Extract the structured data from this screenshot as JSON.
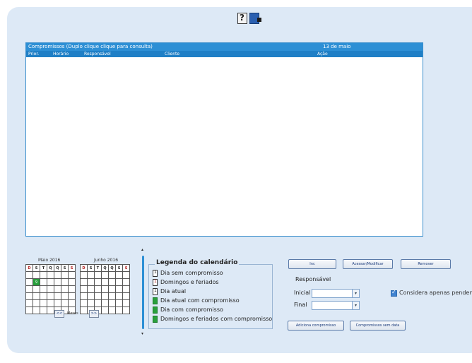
{
  "toolbar": {
    "icons": [
      "help-icon",
      "exit-icon"
    ]
  },
  "grid": {
    "caption": "Compromissos (Duplo clique clique para consulta)",
    "caption_right": "13 de maio",
    "columns": [
      "Prior.",
      "Horário",
      "Responsável",
      "Cliente",
      "Ação"
    ]
  },
  "calendar": {
    "month_left": "Maio 2016",
    "month_right": "Junho 2016",
    "weekday_headers": [
      "D",
      "S",
      "T",
      "Q",
      "Q",
      "S",
      "S"
    ],
    "nav_prev": "<<",
    "nav_label": "Meses",
    "nav_next": ">>",
    "today_day": "9",
    "today_color": "#28a03c"
  },
  "legend": {
    "title": "Legenda do calendário",
    "items": [
      {
        "label": "Dia sem compromisso",
        "swatch": "white",
        "num": "1"
      },
      {
        "label": "Domingos e feriados",
        "swatch": "white-red",
        "num": "1"
      },
      {
        "label": "Dia atual",
        "swatch": "white",
        "num": "1"
      },
      {
        "label": "Dia atual com compromisso",
        "swatch": "green"
      },
      {
        "label": "Dia com compromisso",
        "swatch": "green"
      },
      {
        "label": "Domingos e feriados com compromisso",
        "swatch": "green"
      }
    ]
  },
  "actions": {
    "btn1": "Inc",
    "btn2": "Acessar/Modificar",
    "btn3": "Remover",
    "responsavel_title": "Responsável",
    "inicial_label": "Inicial",
    "final_label": "Final",
    "inicial_value": "",
    "final_value": "",
    "add_btn": "Adiciona compromisso",
    "nodate_btn": "Compromissos sem data",
    "pending_label": "Considera apenas pendentes",
    "pending_checked": true
  },
  "colors": {
    "frame": "#dde9f6",
    "grid_header": "#1f7fc6",
    "accent": "#2d8fd5"
  }
}
